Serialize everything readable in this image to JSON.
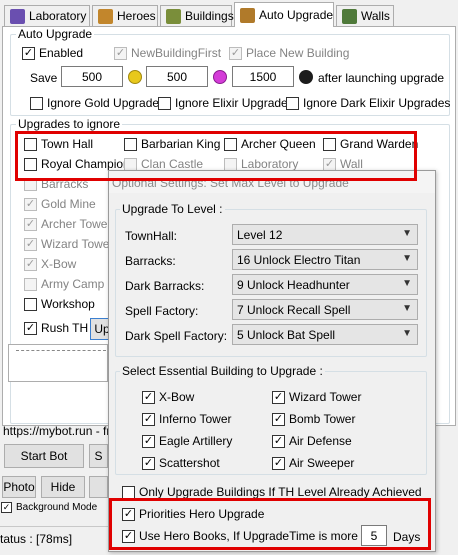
{
  "tabs": [
    {
      "label": "Laboratory",
      "icon": "flask-icon",
      "color": "#6a4fb0"
    },
    {
      "label": "Heroes",
      "icon": "hero-icon",
      "color": "#c2862c"
    },
    {
      "label": "Buildings",
      "icon": "building-icon",
      "color": "#7a8e3a"
    },
    {
      "label": "Auto Upgrade",
      "icon": "hammer-icon",
      "color": "#b07a2a"
    },
    {
      "label": "Walls",
      "icon": "wall-icon",
      "color": "#4f7a3a"
    }
  ],
  "auto_upgrade": {
    "group_label": "Auto Upgrade",
    "enabled_label": "Enabled",
    "new_building_first_label": "NewBuildingFirst",
    "place_new_building_label": "Place New Building",
    "save_label": "Save",
    "gold_value": "500",
    "elixir_value": "500",
    "dark_value": "1500",
    "after_label": "after launching upgrade",
    "ignore_gold_label": "Ignore Gold Upgrades",
    "ignore_elixir_label": "Ignore Elixir Upgrades",
    "ignore_dark_label": "Ignore Dark Elixir Upgrades"
  },
  "ignore": {
    "group_label": "Upgrades to ignore",
    "row1": [
      "Town Hall",
      "Barbarian King",
      "Archer Queen",
      "Grand Warden"
    ],
    "row2": [
      "Royal Champion",
      "Clan Castle",
      "Laboratory",
      "Wall"
    ],
    "left_column": [
      "Barracks",
      "Gold Mine",
      "Archer Tower",
      "Wizard Tower",
      "X-Bow",
      "Army Camp",
      "Workshop"
    ]
  },
  "rush_th_label": "Rush TH",
  "upg_button_label": "Up",
  "url_text": "https://mybot.run - fre",
  "bottom": {
    "start_bot": "Start Bot",
    "start_bot_2": "S",
    "photo": "Photo",
    "hide": "Hide",
    "background_mode": "Background Mode",
    "status": "tatus : [78ms]"
  },
  "dialog": {
    "title": "Optional Settings: Set Max Level to Upgrade",
    "upgrade_group_label": "Upgrade To Level :",
    "rows": [
      {
        "label": "TownHall:",
        "value": "Level 12"
      },
      {
        "label": "Barracks:",
        "value": "16 Unlock Electro Titan"
      },
      {
        "label": "Dark Barracks:",
        "value": "9 Unlock Headhunter"
      },
      {
        "label": "Spell Factory:",
        "value": "7 Unlock Recall Spell"
      },
      {
        "label": "Dark Spell Factory:",
        "value": "5 Unlock Bat Spell"
      }
    ],
    "essential_group_label": "Select Essential Building to Upgrade :",
    "essential_left": [
      "X-Bow",
      "Inferno Tower",
      "Eagle Artillery",
      "Scattershot"
    ],
    "essential_right": [
      "Wizard Tower",
      "Bomb Tower",
      "Air Defense",
      "Air Sweeper"
    ],
    "only_th_label": "Only Upgrade Buildings If TH Level Already Achieved",
    "priorities_hero_label": "Priorities Hero Upgrade",
    "hero_books_label": "Use Hero Books, If UpgradeTime is more than",
    "hero_books_days_value": "5",
    "days_label": "Days"
  },
  "colors": {
    "highlight": "#e00000",
    "gold_coin": "#e8c81c",
    "elixir_coin": "#d43cd8",
    "dark_coin": "#1c1c1c"
  }
}
